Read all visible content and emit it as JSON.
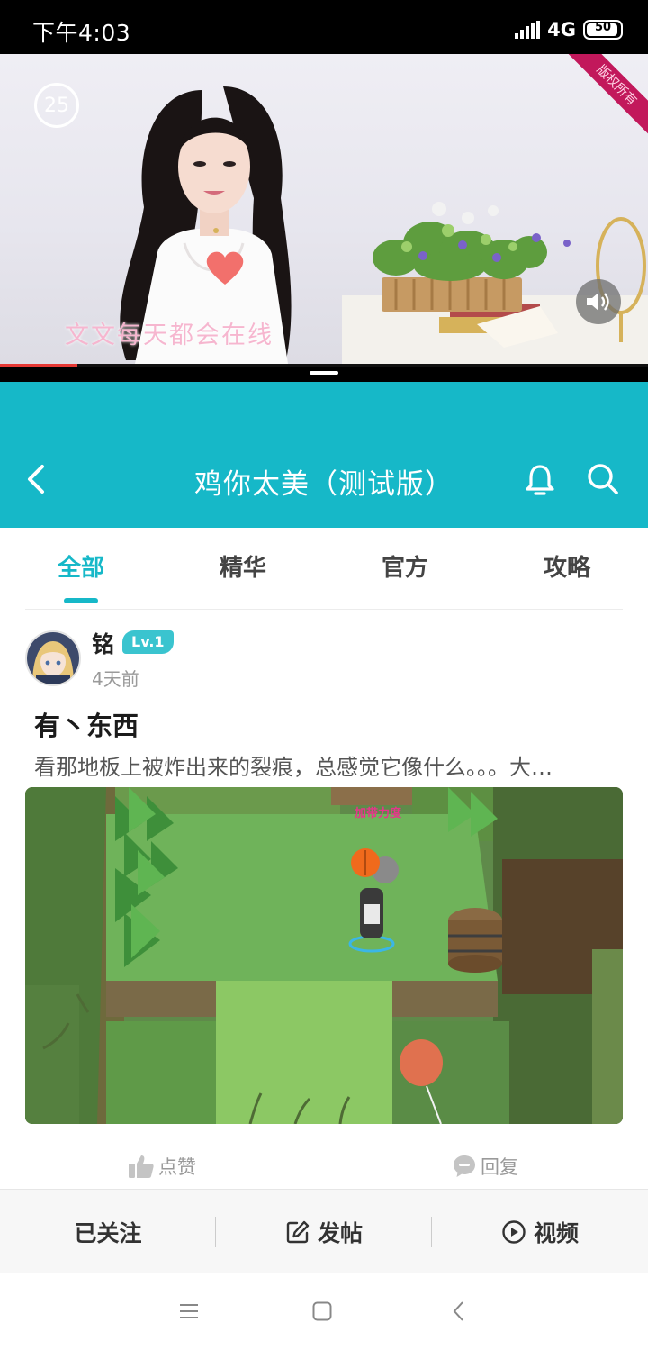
{
  "status_bar": {
    "time": "下午4:03",
    "network": "4G",
    "battery": "50"
  },
  "video": {
    "countdown": "25",
    "caption": "文文每天都会在线",
    "watermark": "版权所有",
    "progress_percent": 12
  },
  "header": {
    "title": "鸡你太美（测试版）"
  },
  "tabs": [
    {
      "label": "全部",
      "active": true
    },
    {
      "label": "精华",
      "active": false
    },
    {
      "label": "官方",
      "active": false
    },
    {
      "label": "攻略",
      "active": false
    }
  ],
  "post": {
    "author": "铭",
    "level": "Lv.1",
    "time": "4天前",
    "title": "有丶东西",
    "excerpt": "看那地板上被炸出来的裂痕，总感觉它像什么。。。大…",
    "image_caption": "加带力度",
    "like_label": "点赞",
    "reply_label": "回复"
  },
  "bottom_bar": {
    "followed_label": "已关注",
    "post_label": "发帖",
    "video_label": "视频"
  },
  "colors": {
    "accent": "#16b8c8",
    "status_bg": "#000000",
    "progress": "#e53935"
  }
}
